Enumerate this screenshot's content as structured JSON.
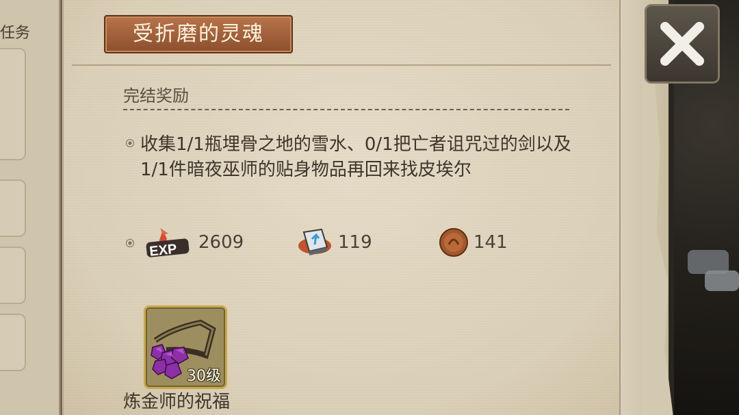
{
  "left_tab": {
    "label": "任务"
  },
  "quest": {
    "title": "受折磨的灵魂"
  },
  "section": {
    "title": "完结奖励"
  },
  "objective": {
    "text": "收集1/1瓶埋骨之地的雪水、0/1把亡者诅咒过的剑以及1/1件暗夜巫师的贴身物品再回来找皮埃尔"
  },
  "rewards": [
    {
      "icon": "exp-icon",
      "value": "2609"
    },
    {
      "icon": "skill-book-icon",
      "value": "119"
    },
    {
      "icon": "coin-icon",
      "value": "141"
    }
  ],
  "item": {
    "name": "炼金师的祝福",
    "level": "30级",
    "icon": "purple-gem-necklace-icon"
  },
  "buttons": {
    "close": "close-icon"
  },
  "colors": {
    "title_bg": "#a3623c",
    "parchment": "#e2d8c3",
    "item_border": "#c9a84a",
    "close_bg": "#4b453c"
  }
}
